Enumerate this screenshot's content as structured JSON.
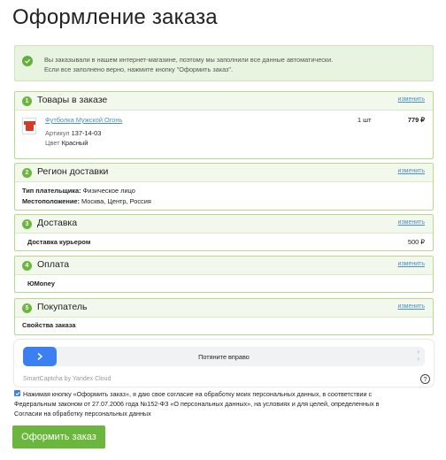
{
  "page": {
    "title": "Оформление заказа"
  },
  "notice": {
    "line1": "Вы заказывали в нашем интернет-магазине, поэтому мы заполнили все данные автоматически.",
    "line2": "Если все заполнено верно, нажмите кнопку \"Оформить заказ\"."
  },
  "sections": [
    {
      "num": "1",
      "title": "Товары в заказе",
      "edit": "изменить"
    },
    {
      "num": "2",
      "title": "Регион доставки",
      "edit": "изменить"
    },
    {
      "num": "3",
      "title": "Доставка",
      "edit": "изменить"
    },
    {
      "num": "4",
      "title": "Оплата",
      "edit": "изменить"
    },
    {
      "num": "5",
      "title": "Покупатель",
      "edit": "изменить"
    }
  ],
  "product": {
    "name": "Футболка Мужской Огонь",
    "article_label": "Артикул",
    "article_value": "137-14-03",
    "color_label": "Цвет",
    "color_value": "Красный",
    "quantity": "1 шт",
    "price": "779 ₽"
  },
  "region": {
    "payer_label": "Тип плательщика:",
    "payer_value": "Физическое лицо",
    "location_label": "Местоположение:",
    "location_value": "Москва, Центр, Россия"
  },
  "delivery": {
    "method": "Доставка курьером",
    "price": "500 ₽"
  },
  "payment": {
    "method": "ЮMoney"
  },
  "buyer": {
    "props": "Свойства заказа"
  },
  "captcha": {
    "slider_text": "Потяните вправо",
    "brand": "SmartCaptcha by Yandex Cloud",
    "help": "?"
  },
  "agreement": {
    "checked": true,
    "line1": "Нажимая кнопку «Оформить заказ», я даю свое согласие на обработку моих персональных данных, в соответствии с",
    "line2": "Федеральным законом от 27.07.2006 года №152-ФЗ «О персональных данных», на условиях и для целей, определенных в",
    "line3": "Согласии на обработку персональных данных"
  },
  "submit": {
    "label": "Оформить заказ"
  },
  "colors": {
    "accent_green": "#6bb63c",
    "border_green": "#b4dc8c",
    "link_blue": "#4a90c8",
    "captcha_blue": "#3c7ff3"
  }
}
